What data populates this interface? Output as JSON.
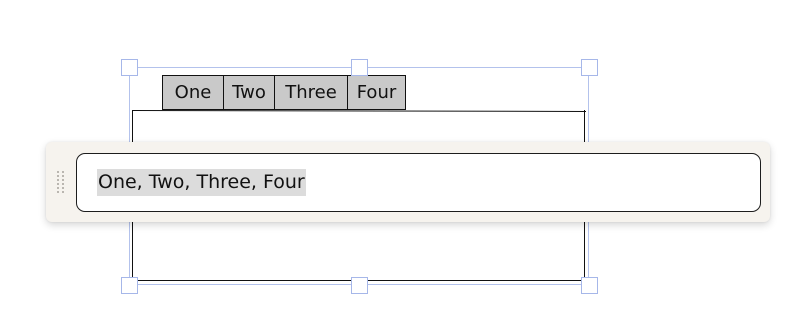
{
  "tab_component": {
    "tabs": [
      {
        "label": "One"
      },
      {
        "label": "Two"
      },
      {
        "label": "Three"
      },
      {
        "label": "Four"
      }
    ]
  },
  "edit_toolbar": {
    "value": "One, Two, Three, Four"
  },
  "colors": {
    "selection": "#b3c2ec",
    "tab_fill": "#c9c9c9",
    "toolbar_bg": "#f6f3ee",
    "highlight": "#dcdcdc"
  }
}
